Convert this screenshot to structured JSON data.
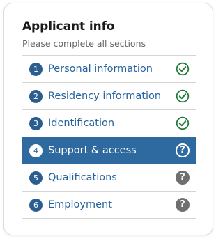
{
  "panel": {
    "title": "Applicant info",
    "subtitle": "Please complete all sections"
  },
  "sections": [
    {
      "number": "1",
      "label": "Personal information",
      "status": "complete",
      "status_icon": "check-circle-icon",
      "active": false
    },
    {
      "number": "2",
      "label": "Residency information",
      "status": "complete",
      "status_icon": "check-circle-icon",
      "active": false
    },
    {
      "number": "3",
      "label": "Identification",
      "status": "complete",
      "status_icon": "check-circle-icon",
      "active": false
    },
    {
      "number": "4",
      "label": "Support & access",
      "status": "incomplete",
      "status_icon": "question-circle-icon",
      "active": true
    },
    {
      "number": "5",
      "label": "Qualifications",
      "status": "incomplete",
      "status_icon": "question-circle-icon",
      "active": false
    },
    {
      "number": "6",
      "label": "Employment",
      "status": "incomplete",
      "status_icon": "question-circle-icon",
      "active": false
    }
  ],
  "colors": {
    "accent": "#2e6a9f",
    "link": "#26639e",
    "complete": "#1f7a3a",
    "incomplete": "#6f6f6f"
  }
}
